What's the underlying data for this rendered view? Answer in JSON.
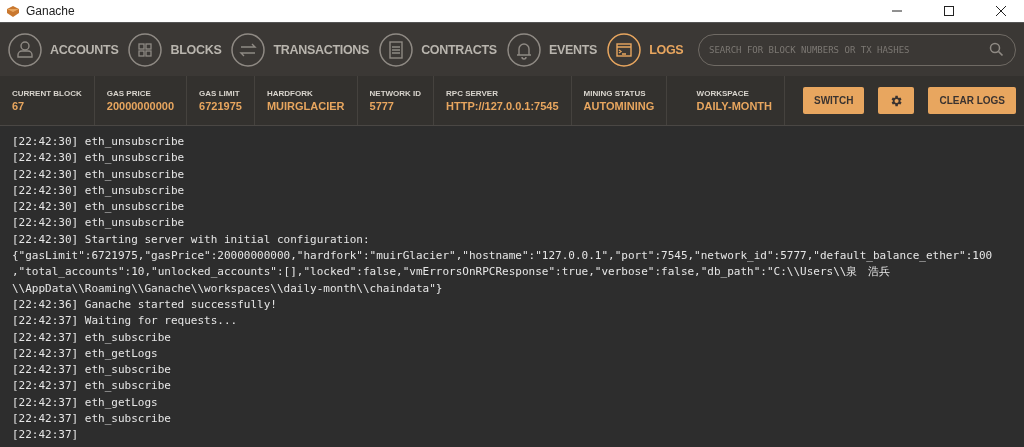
{
  "window": {
    "title": "Ganache"
  },
  "nav": [
    {
      "label": "ACCOUNTS",
      "selected": false
    },
    {
      "label": "BLOCKS",
      "selected": false
    },
    {
      "label": "TRANSACTIONS",
      "selected": false
    },
    {
      "label": "CONTRACTS",
      "selected": false
    },
    {
      "label": "EVENTS",
      "selected": false
    },
    {
      "label": "LOGS",
      "selected": true
    }
  ],
  "search": {
    "placeholder": "SEARCH FOR BLOCK NUMBERS OR TX HASHES"
  },
  "stats": [
    {
      "label": "CURRENT BLOCK",
      "value": "67"
    },
    {
      "label": "GAS PRICE",
      "value": "20000000000"
    },
    {
      "label": "GAS LIMIT",
      "value": "6721975"
    },
    {
      "label": "HARDFORK",
      "value": "MUIRGLACIER"
    },
    {
      "label": "NETWORK ID",
      "value": "5777"
    },
    {
      "label": "RPC SERVER",
      "value": "HTTP://127.0.0.1:7545"
    },
    {
      "label": "MINING STATUS",
      "value": "AUTOMINING"
    }
  ],
  "workspace": {
    "label": "WORKSPACE",
    "value": "DAILY-MONTH"
  },
  "buttons": {
    "switch": "SWITCH",
    "clear": "CLEAR LOGS"
  },
  "log_lines": [
    "[22:42:30] eth_unsubscribe",
    "[22:42:30] eth_unsubscribe",
    "[22:42:30] eth_unsubscribe",
    "[22:42:30] eth_unsubscribe",
    "[22:42:30] eth_unsubscribe",
    "[22:42:30] eth_unsubscribe",
    "[22:42:30] Starting server with initial configuration:",
    "{\"gasLimit\":6721975,\"gasPrice\":20000000000,\"hardfork\":\"muirGlacier\",\"hostname\":\"127.0.0.1\",\"port\":7545,\"network_id\":5777,\"default_balance_ether\":100",
    ",\"total_accounts\":10,\"unlocked_accounts\":[],\"locked\":false,\"vmErrorsOnRPCResponse\":true,\"verbose\":false,\"db_path\":\"C:\\\\Users\\\\泉　浩兵",
    "\\\\AppData\\\\Roaming\\\\Ganache\\\\workspaces\\\\daily-month\\\\chaindata\"}",
    "[22:42:36] Ganache started successfully!",
    "[22:42:37] Waiting for requests...",
    "[22:42:37] eth_subscribe",
    "[22:42:37] eth_getLogs",
    "[22:42:37] eth_subscribe",
    "[22:42:37] eth_subscribe",
    "[22:42:37] eth_getLogs",
    "[22:42:37] eth_subscribe",
    "[22:42:37]"
  ]
}
